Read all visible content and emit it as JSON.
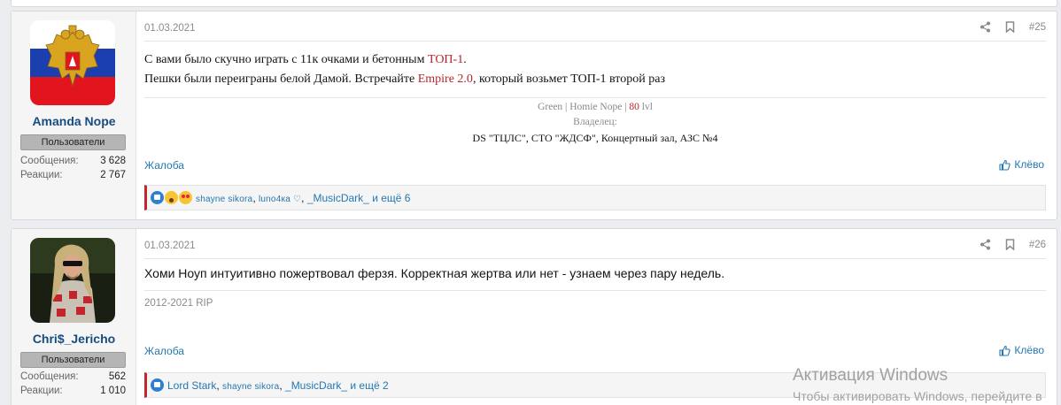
{
  "posts": [
    {
      "username": "Amanda Nope",
      "user_title": "Пользователи",
      "messages_label": "Сообщения:",
      "messages_value": "3 628",
      "reactions_label": "Реакции:",
      "reactions_value": "2 767",
      "date": "01.03.2021",
      "post_number": "#25",
      "body_line1_a": "С вами было скучно играть с 11к очками и бетонным ",
      "body_line1_b": "ТОП-1",
      "body_line1_c": ".",
      "body_line2_a": "Пешки были переиграны белой Дамой. Встречайте ",
      "body_line2_b": "Empire 2.0",
      "body_line2_c": ", который возьмет ТОП-1 второй раз",
      "sig_line1_a": "Green | Homie Nope | ",
      "sig_line1_b": "80",
      "sig_line1_c": " lvl",
      "sig_line2": "Владелец:",
      "sig_line3": "DS \"ТЦЛС\", СТО \"ЖДСФ\", Концертный зал, АЗС №4",
      "report_label": "Жалоба",
      "like_label": "Клёво",
      "reactions_users": [
        {
          "name": "shayne sikora",
          "smallcaps": true
        },
        {
          "name": "luno4ка ♡",
          "smallcaps": true
        },
        {
          "name": "_MusicDark_",
          "smallcaps": false
        }
      ],
      "reactions_more": "и ещё 6"
    },
    {
      "username": "Chri$_Jericho",
      "user_title": "Пользователи",
      "messages_label": "Сообщения:",
      "messages_value": "562",
      "reactions_label": "Реакции:",
      "reactions_value": "1 010",
      "date": "01.03.2021",
      "post_number": "#26",
      "body": "Хоми Ноуп интуитивно пожертвовал ферзя. Корректная жертва или нет - узнаем через пару недель.",
      "signature": "2012-2021 RIP",
      "report_label": "Жалоба",
      "like_label": "Клёво",
      "reactions_users": [
        {
          "name": "Lord Stark",
          "smallcaps": false
        },
        {
          "name": "shayne sikora",
          "smallcaps": true
        },
        {
          "name": "_MusicDark_",
          "smallcaps": false
        }
      ],
      "reactions_more": "и ещё 2"
    }
  ],
  "watermark": {
    "line1": "Активация Windows",
    "line2": "Чтобы активировать Windows, перейдите в"
  },
  "colors": {
    "accent_link": "#2577b1",
    "username": "#184c81",
    "highlight_red": "#b7242a"
  }
}
